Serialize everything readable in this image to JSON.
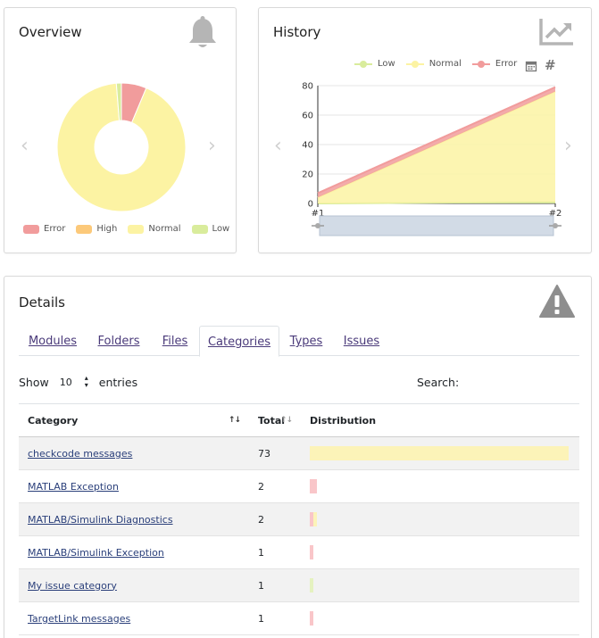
{
  "overview": {
    "title": "Overview",
    "legend": [
      {
        "label": "Error",
        "color": "#f19c9c"
      },
      {
        "label": "High",
        "color": "#fcc97a"
      },
      {
        "label": "Normal",
        "color": "#fcf3a3"
      },
      {
        "label": "Low",
        "color": "#d9ec9c"
      }
    ],
    "donut": {
      "Error": 5,
      "High": 0,
      "Normal": 73,
      "Low": 1
    }
  },
  "history": {
    "title": "History",
    "legend": [
      {
        "label": "Low",
        "color": "#d9ec9c"
      },
      {
        "label": "Normal",
        "color": "#fcf3a3"
      },
      {
        "label": "Error",
        "color": "#f19c9c"
      }
    ]
  },
  "chart_data": {
    "type": "area",
    "x": [
      "#1",
      "#2"
    ],
    "ylim": [
      0,
      80
    ],
    "yticks": [
      0,
      20,
      40,
      60,
      80
    ],
    "series": [
      {
        "name": "Low",
        "values": [
          0,
          1
        ],
        "color": "#d9ec9c"
      },
      {
        "name": "Normal",
        "values": [
          4,
          75
        ],
        "color": "#fcf3a3"
      },
      {
        "name": "Error",
        "values": [
          3,
          3
        ],
        "color": "#f19c9c"
      }
    ],
    "legend_position": "top"
  },
  "details": {
    "title": "Details",
    "tabs": [
      {
        "label": "Modules",
        "active": false
      },
      {
        "label": "Folders",
        "active": false
      },
      {
        "label": "Files",
        "active": false
      },
      {
        "label": "Categories",
        "active": true
      },
      {
        "label": "Types",
        "active": false
      },
      {
        "label": "Issues",
        "active": false
      }
    ],
    "show_label": "Show",
    "entries_value": "10",
    "entries_label": "entries",
    "search_label": "Search:",
    "columns": [
      "Category",
      "Total",
      "Distribution"
    ],
    "rows": [
      {
        "category": "checkcode messages",
        "total": "73",
        "dist": {
          "error": 0,
          "normal": 73,
          "low": 0
        }
      },
      {
        "category": "MATLAB Exception",
        "total": "2",
        "dist": {
          "error": 2,
          "normal": 0,
          "low": 0
        }
      },
      {
        "category": "MATLAB/Simulink Diagnostics",
        "total": "2",
        "dist": {
          "error": 1,
          "normal": 1,
          "low": 0
        }
      },
      {
        "category": "MATLAB/Simulink Exception",
        "total": "1",
        "dist": {
          "error": 1,
          "normal": 0,
          "low": 0
        }
      },
      {
        "category": "My issue category",
        "total": "1",
        "dist": {
          "error": 0,
          "normal": 0,
          "low": 1
        }
      },
      {
        "category": "TargetLink messages",
        "total": "1",
        "dist": {
          "error": 1,
          "normal": 0,
          "low": 0
        }
      }
    ],
    "dist_max": 73
  }
}
